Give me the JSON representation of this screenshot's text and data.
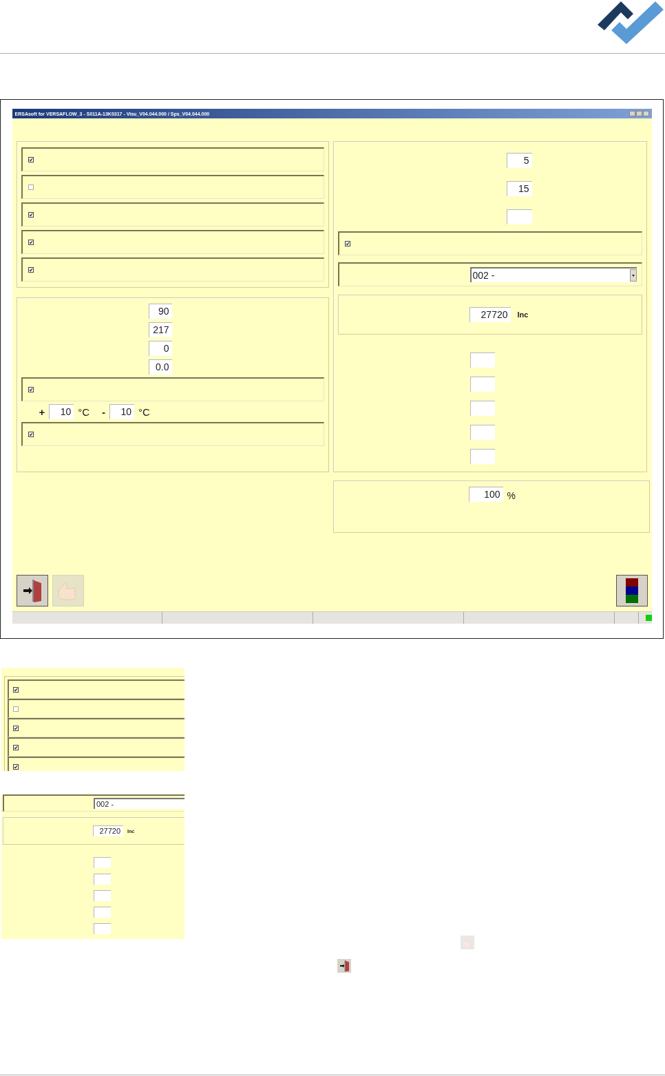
{
  "window": {
    "title": "ERSAsoft for VERSAFLOW_3 - S011A-13K0317 - Visu_V04.044.000 / Sps_V04.044.000"
  },
  "left_group": {
    "options": [
      {
        "checked": true
      },
      {
        "checked": false
      },
      {
        "checked": true
      },
      {
        "checked": true
      },
      {
        "checked": true
      }
    ]
  },
  "parameters": {
    "values": [
      "90",
      "217",
      "0",
      "0.0"
    ],
    "option_1": {
      "checked": true
    },
    "tolerance": {
      "plus_sign": "+",
      "plus_value": "10",
      "plus_unit": "°C",
      "minus_sign": "-",
      "minus_value": "10",
      "minus_unit": "°C"
    },
    "option_2": {
      "checked": true
    }
  },
  "right_group": {
    "fields": [
      {
        "kind": "value",
        "value": "5"
      },
      {
        "kind": "value",
        "value": "15"
      },
      {
        "kind": "blank"
      }
    ],
    "option": {
      "checked": true
    },
    "dropdown": {
      "value": "002 -"
    },
    "position": {
      "value": "27720",
      "unit": "Inc"
    },
    "blank_fields": [
      {
        "kind": "blank"
      },
      {
        "kind": "blank"
      },
      {
        "kind": "blank"
      },
      {
        "kind": "blank"
      },
      {
        "kind": "blank"
      }
    ]
  },
  "speed": {
    "value": "100",
    "unit": "%"
  },
  "toolbar": {
    "confirm_disabled": true
  },
  "excerpt_1": {
    "options": [
      {
        "checked": true
      },
      {
        "checked": false
      },
      {
        "checked": true
      },
      {
        "checked": true
      },
      {
        "checked": true
      }
    ]
  },
  "excerpt_2": {
    "dropdown": {
      "value": "002 -"
    },
    "position": {
      "value": "27720",
      "unit": "Inc"
    },
    "blank_fields": [
      {
        "kind": "blank"
      },
      {
        "kind": "blank"
      },
      {
        "kind": "blank"
      },
      {
        "kind": "blank"
      },
      {
        "kind": "blank"
      }
    ]
  },
  "inline_icons": {
    "confirm_disabled": true
  }
}
